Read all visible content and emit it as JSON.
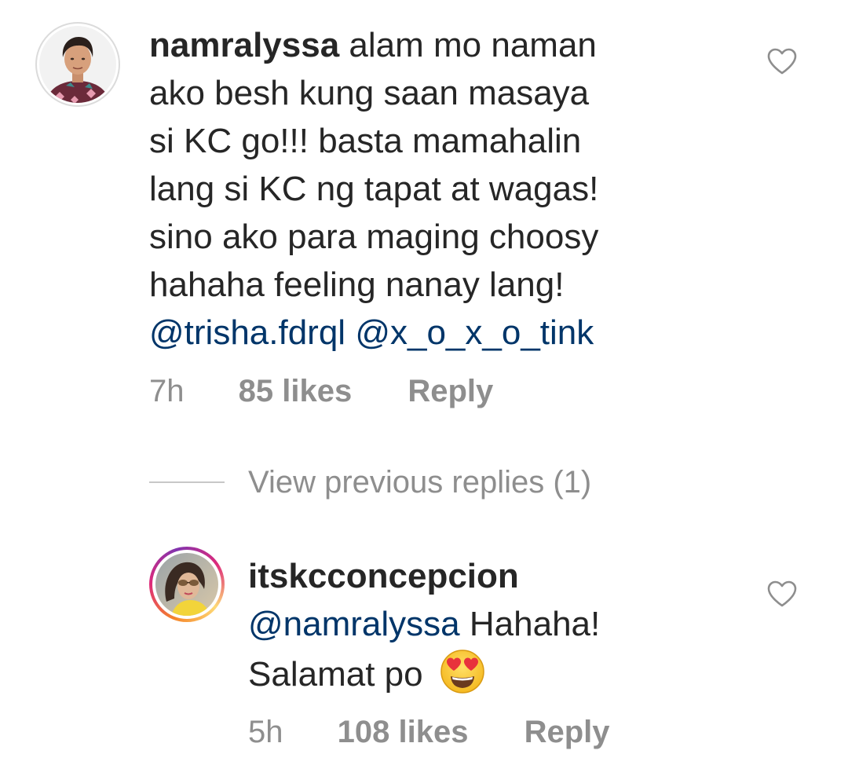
{
  "comments": [
    {
      "username": "namralyssa",
      "text_lines": [
        "alam mo naman",
        "ako besh kung saan masaya",
        "si KC go!!! basta mamahalin",
        "lang si KC ng tapat at wagas!",
        "sino ako para maging choosy",
        "hahaha feeling nanay lang!"
      ],
      "mentions": [
        "@trisha.fdrql",
        "@x_o_x_o_tink"
      ],
      "time": "7h",
      "likes": "85 likes",
      "reply_label": "Reply",
      "like_icon": "heart-outline-icon"
    }
  ],
  "view_replies": {
    "label": "View previous replies (1)"
  },
  "replies": [
    {
      "username": "itskcconcepcion",
      "mention": "@namralyssa",
      "text_line_1": "Hahaha!",
      "text_line_2": "Salamat po",
      "emoji": "heart-eyes-emoji",
      "time": "5h",
      "likes": "108 likes",
      "reply_label": "Reply",
      "like_icon": "heart-outline-icon",
      "has_story_ring": true
    }
  ],
  "colors": {
    "text": "#262626",
    "secondary": "#8e8e8e",
    "mention": "#003569",
    "divider": "#c7c7c7"
  }
}
